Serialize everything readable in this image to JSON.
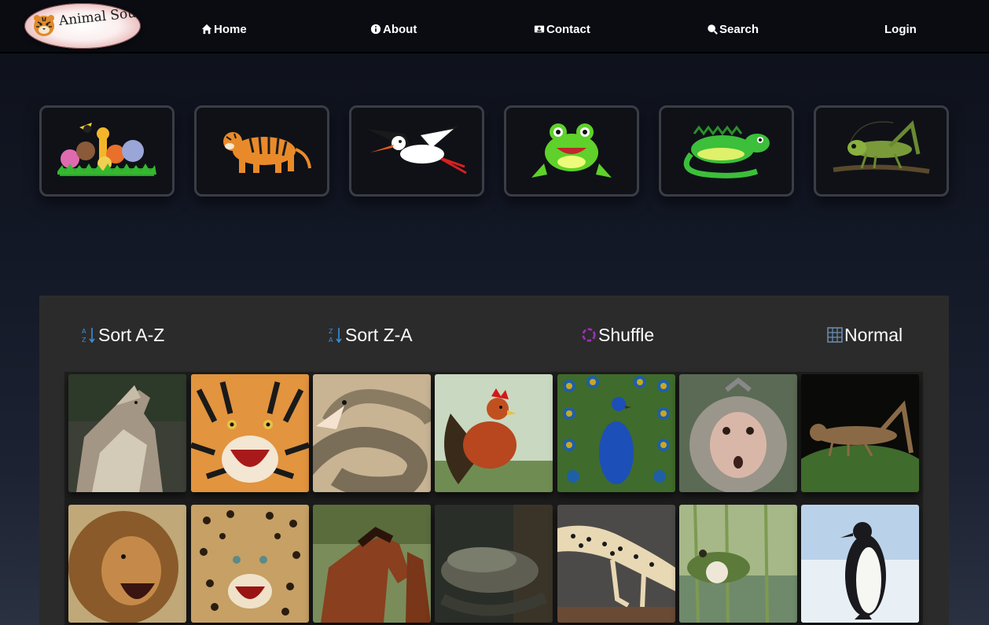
{
  "brand": {
    "logo_text": "Animal Sounds"
  },
  "nav": [
    {
      "label": "Home",
      "icon": "home-icon"
    },
    {
      "label": "About",
      "icon": "info-icon"
    },
    {
      "label": "Contact",
      "icon": "contact-card-icon"
    },
    {
      "label": "Search",
      "icon": "search-icon"
    },
    {
      "label": "Login",
      "icon": ""
    }
  ],
  "categories": [
    {
      "name": "all-animals",
      "icon": "animal-group-icon"
    },
    {
      "name": "mammals",
      "icon": "tiger-icon"
    },
    {
      "name": "birds",
      "icon": "stork-icon"
    },
    {
      "name": "amphibians",
      "icon": "frog-icon"
    },
    {
      "name": "reptiles",
      "icon": "iguana-icon"
    },
    {
      "name": "insects",
      "icon": "grasshopper-icon"
    }
  ],
  "toolbar": {
    "sort_az": "Sort A-Z",
    "sort_za": "Sort Z-A",
    "shuffle": "Shuffle",
    "normal": "Normal"
  },
  "animals": [
    {
      "name": "wolf"
    },
    {
      "name": "tiger"
    },
    {
      "name": "snake"
    },
    {
      "name": "rooster"
    },
    {
      "name": "peacock"
    },
    {
      "name": "monkey"
    },
    {
      "name": "grasshopper"
    },
    {
      "name": "lion"
    },
    {
      "name": "leopard"
    },
    {
      "name": "horse"
    },
    {
      "name": "salamander"
    },
    {
      "name": "gecko"
    },
    {
      "name": "frog"
    },
    {
      "name": "penguin"
    }
  ],
  "colors": {
    "navbar_bg": "#0a0c12",
    "panel_bg": "#2b2b2b",
    "sort_icon": "#3a8fd6",
    "shuffle_icon": "#9b2fb8",
    "normal_icon": "#6d8fb3"
  }
}
